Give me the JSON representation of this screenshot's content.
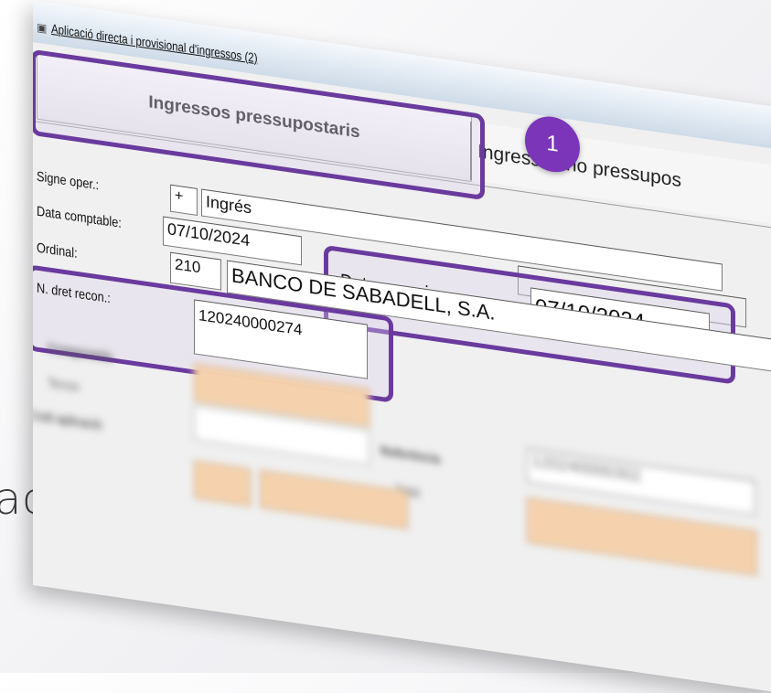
{
  "window": {
    "title": "Aplicació directa i provisional d'ingressos (2)"
  },
  "tabs": [
    {
      "label": "Ingressos pressupostaris",
      "active": true
    },
    {
      "label": "Ingressos no pressupos",
      "active": false
    }
  ],
  "callout": {
    "number": "1"
  },
  "form": {
    "signe": {
      "label": "Signe oper.:",
      "value": "+",
      "text": "Ingrés"
    },
    "data_comptable": {
      "label": "Data comptable:",
      "value": "07/10/2024"
    },
    "data_arqueig": {
      "label": "Data arqueig:",
      "value": "07/10/2024"
    },
    "ordinal": {
      "label": "Ordinal:",
      "value": "210",
      "name": "BANCO DE SABADELL, S.A."
    },
    "n_dret": {
      "label": "N. dret recon.:",
      "value": "120240000274"
    }
  },
  "blurred": {
    "compromis": "Compromís",
    "tercer": "Tercer",
    "codi": "Codi aplicació",
    "referencia": "Referència",
    "ref_value": "120240000302",
    "total": "Total"
  },
  "background_text": "acte",
  "colors": {
    "highlight": "#6a3a9e",
    "badge": "#7b35b8",
    "peach": "#f5d2ad"
  }
}
